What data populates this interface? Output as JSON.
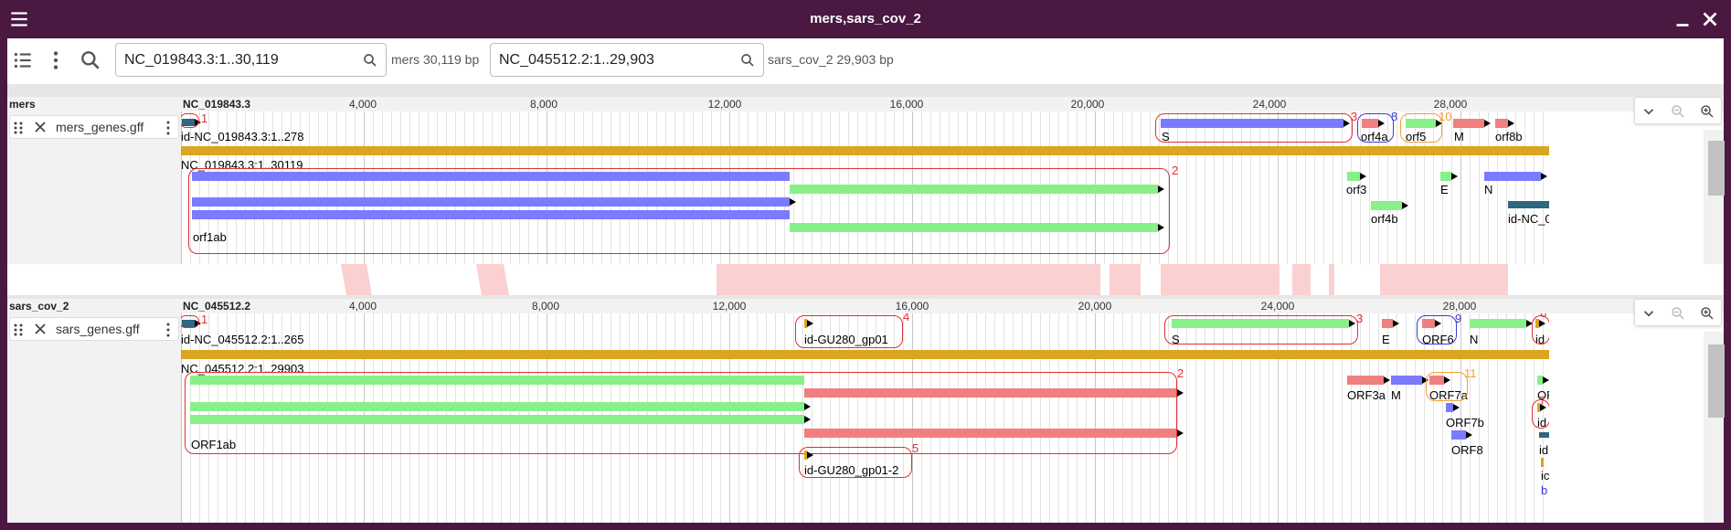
{
  "window": {
    "title": "mers,sars_cov_2"
  },
  "toolbar": {
    "view1_loc": "NC_019843.3:1..30,119",
    "view1_asm": "mers 30,119 bp",
    "view2_loc": "NC_045512.2:1..29,903",
    "view2_asm": "sars_cov_2 29,903 bp"
  },
  "icons": [
    "menu-icon",
    "minimize-icon",
    "close-icon",
    "track-list-icon",
    "more-vert-icon",
    "search-icon",
    "drag-handle-icon",
    "collapse-icon",
    "zoom-out-icon",
    "zoom-in-icon"
  ],
  "colors": {
    "titlebar": "#4a1840",
    "gene": "#daa520",
    "cds_blue": "#7b7bff",
    "cds_green": "#88f088",
    "cds_red": "#f07f7f",
    "highlight": "#e03030",
    "synteny": "#fbd0d0"
  },
  "views": [
    {
      "assembly": "mers",
      "refname": "NC_019843.3",
      "ruler": [
        "4,000",
        "8,000",
        "12,000",
        "16,000",
        "20,000",
        "24,000",
        "28,000"
      ],
      "track": "mers_genes.gff",
      "labels": {
        "region": "id-NC_019843.3:1..278",
        "gene": "NC_019843.3:1..30119",
        "orf1ab": "orf1ab",
        "S": "S",
        "orf4a": "orf4a",
        "orf5": "orf5",
        "M": "M",
        "orf8b": "orf8b",
        "orf3": "orf3",
        "E": "E",
        "N": "N",
        "orf4b": "orf4b",
        "idnc": "id-NC_0"
      },
      "nums": [
        "1",
        "2",
        "3",
        "8",
        "10",
        "1"
      ]
    },
    {
      "assembly": "sars_cov_2",
      "refname": "NC_045512.2",
      "ruler": [
        "4,000",
        "8,000",
        "12,000",
        "16,000",
        "20,000",
        "24,000",
        "28,000"
      ],
      "track": "sars_genes.gff",
      "labels": {
        "region": "id-NC_045512.2:1..265",
        "gene": "NC_045512.2:1..29903",
        "orf1ab": "ORF1ab",
        "gp01": "id-GU280_gp01",
        "gp01b": "id-GU280_gp01-2",
        "S": "S",
        "E": "E",
        "ORF6": "ORF6",
        "N": "N",
        "id": "id",
        "ORF3a": "ORF3a",
        "M": "M",
        "ORF7a": "ORF7a",
        "OR": "OR",
        "ORF7b": "ORF7b",
        "ORF8": "ORF8",
        "id2": "id",
        "id3": "id",
        "ic": "ic",
        "b": "b"
      },
      "nums": [
        "1",
        "4",
        "2",
        "3",
        "9",
        "6",
        "11",
        "5",
        "7"
      ]
    }
  ]
}
